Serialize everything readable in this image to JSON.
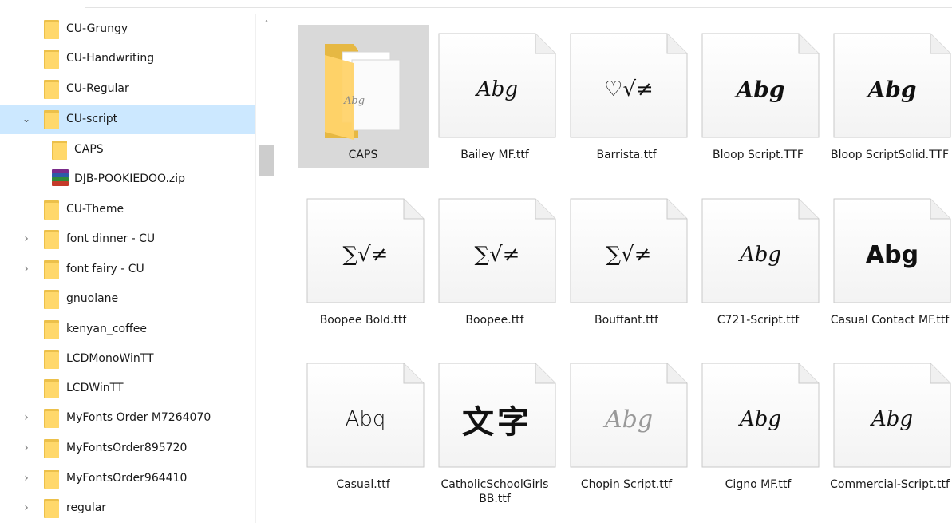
{
  "nav": {
    "items": [
      {
        "label": "CU-Grungy",
        "type": "folder",
        "expander": ""
      },
      {
        "label": "CU-Handwriting",
        "type": "folder",
        "expander": ""
      },
      {
        "label": "CU-Regular",
        "type": "folder",
        "expander": ""
      },
      {
        "label": "CU-script",
        "type": "folder",
        "expander": "expanded",
        "selected": true
      },
      {
        "label": "CAPS",
        "type": "folder",
        "expander": "",
        "indent": 1
      },
      {
        "label": "DJB-POOKIEDOO.zip",
        "type": "zip",
        "expander": "",
        "indent": 1
      },
      {
        "label": "CU-Theme",
        "type": "folder",
        "expander": ""
      },
      {
        "label": "font dinner - CU",
        "type": "folder",
        "expander": "collapsed"
      },
      {
        "label": "font fairy - CU",
        "type": "folder",
        "expander": "collapsed"
      },
      {
        "label": "gnuolane",
        "type": "folder",
        "expander": ""
      },
      {
        "label": "kenyan_coffee",
        "type": "folder",
        "expander": ""
      },
      {
        "label": "LCDMonoWinTT",
        "type": "folder",
        "expander": ""
      },
      {
        "label": "LCDWinTT",
        "type": "folder",
        "expander": ""
      },
      {
        "label": "MyFonts Order M7264070",
        "type": "folder",
        "expander": "collapsed"
      },
      {
        "label": "MyFontsOrder895720",
        "type": "folder",
        "expander": "collapsed"
      },
      {
        "label": "MyFontsOrder964410",
        "type": "folder",
        "expander": "collapsed"
      },
      {
        "label": "regular",
        "type": "folder",
        "expander": "collapsed"
      }
    ],
    "chevron_open": "⌄",
    "chevron_closed": "›"
  },
  "scrollbar": {
    "up_arrow": "˄"
  },
  "files": [
    {
      "name": "CAPS",
      "kind": "folder",
      "preview": "Abg",
      "selected": true
    },
    {
      "name": "Bailey MF.ttf",
      "kind": "font",
      "preview": "Abg",
      "style": "script1"
    },
    {
      "name": "Barrista.ttf",
      "kind": "font",
      "preview": "♡√≠",
      "style": "sym"
    },
    {
      "name": "Bloop Script.TTF",
      "kind": "font",
      "preview": "Abg",
      "style": "bold"
    },
    {
      "name": "Bloop ScriptSolid.TTF",
      "kind": "font",
      "preview": "Abg",
      "style": "bold"
    },
    {
      "name": "Boopee Bold.ttf",
      "kind": "font",
      "preview": "∑√≠",
      "style": "sym"
    },
    {
      "name": "Boopee.ttf",
      "kind": "font",
      "preview": "∑√≠",
      "style": "sym"
    },
    {
      "name": "Bouffant.ttf",
      "kind": "font",
      "preview": "∑√≠",
      "style": "sym"
    },
    {
      "name": "C721-Script.ttf",
      "kind": "font",
      "preview": "Abg",
      "style": "script1"
    },
    {
      "name": "Casual Contact MF.ttf",
      "kind": "font",
      "preview": "Abg",
      "style": "sans-bold"
    },
    {
      "name": "Casual.ttf",
      "kind": "font",
      "preview": "Abq",
      "style": "hand"
    },
    {
      "name": "CatholicSchoolGirls BB.ttf",
      "kind": "font",
      "preview": "文字",
      "style": "cjk"
    },
    {
      "name": "Chopin Script.ttf",
      "kind": "font",
      "preview": "Abg",
      "style": "light"
    },
    {
      "name": "Cigno MF.ttf",
      "kind": "font",
      "preview": "Abg",
      "style": "script1"
    },
    {
      "name": "Commercial-Script.ttf",
      "kind": "font",
      "preview": "Abg",
      "style": "script1"
    }
  ],
  "colors": {
    "selection_nav": "#cce8ff",
    "selection_tile": "#d9d9d9",
    "folder_front": "#ffd86b",
    "folder_back": "#ecc04a"
  }
}
